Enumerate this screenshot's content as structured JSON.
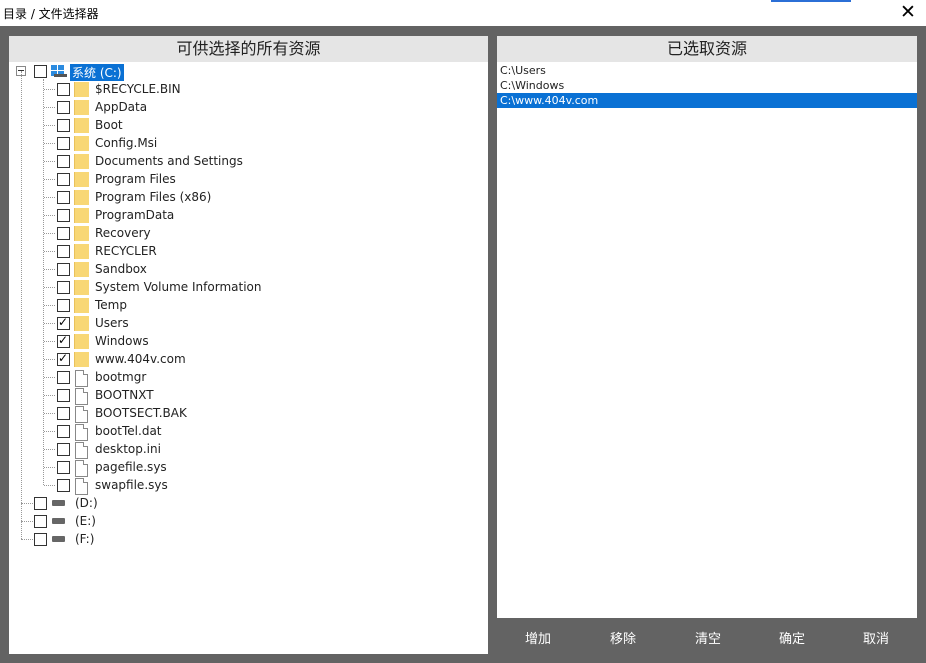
{
  "window": {
    "title": "目录 / 文件选择器",
    "close_glyph": "✕"
  },
  "left_panel": {
    "header": "可供选择的所有资源",
    "root": {
      "label": "系统 (C:)",
      "expanded": true
    },
    "children": [
      {
        "label": "$RECYCLE.BIN",
        "type": "folder",
        "checked": false
      },
      {
        "label": "AppData",
        "type": "folder",
        "checked": false
      },
      {
        "label": "Boot",
        "type": "folder",
        "checked": false
      },
      {
        "label": "Config.Msi",
        "type": "folder",
        "checked": false
      },
      {
        "label": "Documents and Settings",
        "type": "folder",
        "checked": false
      },
      {
        "label": "Program Files",
        "type": "folder",
        "checked": false
      },
      {
        "label": "Program Files (x86)",
        "type": "folder",
        "checked": false
      },
      {
        "label": "ProgramData",
        "type": "folder",
        "checked": false
      },
      {
        "label": "Recovery",
        "type": "folder",
        "checked": false
      },
      {
        "label": "RECYCLER",
        "type": "folder",
        "checked": false
      },
      {
        "label": "Sandbox",
        "type": "folder",
        "checked": false
      },
      {
        "label": "System Volume Information",
        "type": "folder",
        "checked": false
      },
      {
        "label": "Temp",
        "type": "folder",
        "checked": false
      },
      {
        "label": "Users",
        "type": "folder",
        "checked": true
      },
      {
        "label": "Windows",
        "type": "folder",
        "checked": true
      },
      {
        "label": "www.404v.com",
        "type": "folder",
        "checked": true
      },
      {
        "label": "bootmgr",
        "type": "file",
        "checked": false
      },
      {
        "label": "BOOTNXT",
        "type": "file",
        "checked": false
      },
      {
        "label": "BOOTSECT.BAK",
        "type": "file",
        "checked": false
      },
      {
        "label": "bootTel.dat",
        "type": "file",
        "checked": false
      },
      {
        "label": "desktop.ini",
        "type": "file",
        "checked": false
      },
      {
        "label": "pagefile.sys",
        "type": "file",
        "checked": false
      },
      {
        "label": "swapfile.sys",
        "type": "file",
        "checked": false
      }
    ],
    "drives": [
      {
        "label": "(D:)",
        "checked": false
      },
      {
        "label": "(E:)",
        "checked": false
      },
      {
        "label": "(F:)",
        "checked": false
      }
    ]
  },
  "right_panel": {
    "header": "已选取资源",
    "items": [
      "C:\\Users",
      "C:\\Windows",
      "C:\\www.404v.com"
    ],
    "active_index": 2
  },
  "buttons": {
    "add": "增加",
    "remove": "移除",
    "clear": "清空",
    "ok": "确定",
    "cancel": "取消"
  },
  "colors": {
    "selection": "#0a71d4",
    "background": "#636363",
    "folder": "#f8d775"
  }
}
